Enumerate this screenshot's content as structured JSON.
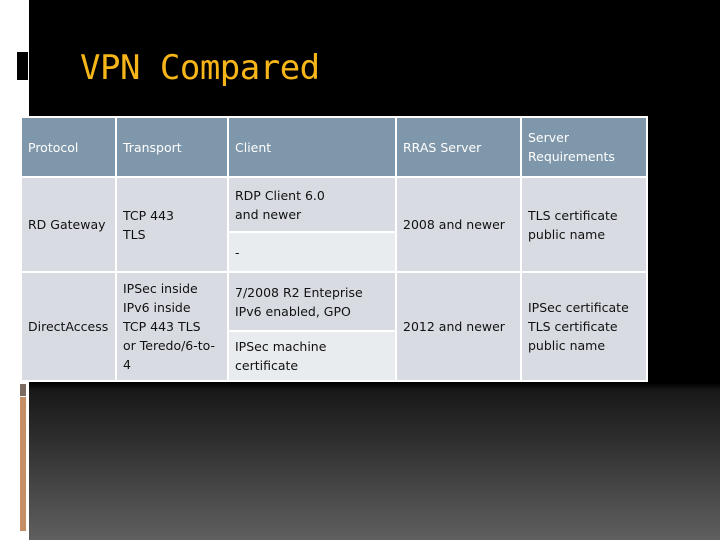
{
  "slide": {
    "title": "VPN Compared",
    "colors": {
      "title": "#f6b519",
      "header_bg": "#7f97ab",
      "cell_bg": "#d8dce2",
      "cell_alt_bg": "#e9ecee",
      "accent_bar": "#c58e64"
    }
  },
  "table": {
    "headers": [
      "Protocol",
      "Transport",
      "Client",
      "RRAS Server",
      "Server\nRequirements"
    ],
    "rows": [
      {
        "protocol": "RD Gateway",
        "transport": "TCP 443\nTLS",
        "client_primary": "RDP Client 6.0\nand newer",
        "client_secondary": "-",
        "rras_server": "2008 and newer",
        "server_requirements": "TLS certificate\npublic name"
      },
      {
        "protocol": "DirectAccess",
        "transport": "IPSec inside\nIPv6 inside\nTCP 443 TLS\nor Teredo/6-to-4",
        "client_primary": "7/2008 R2 Enteprise\nIPv6 enabled, GPO",
        "client_secondary": "IPSec machine\ncertificate",
        "rras_server": "2012 and newer",
        "server_requirements": "IPSec certificate\nTLS certificate\npublic name"
      }
    ]
  }
}
